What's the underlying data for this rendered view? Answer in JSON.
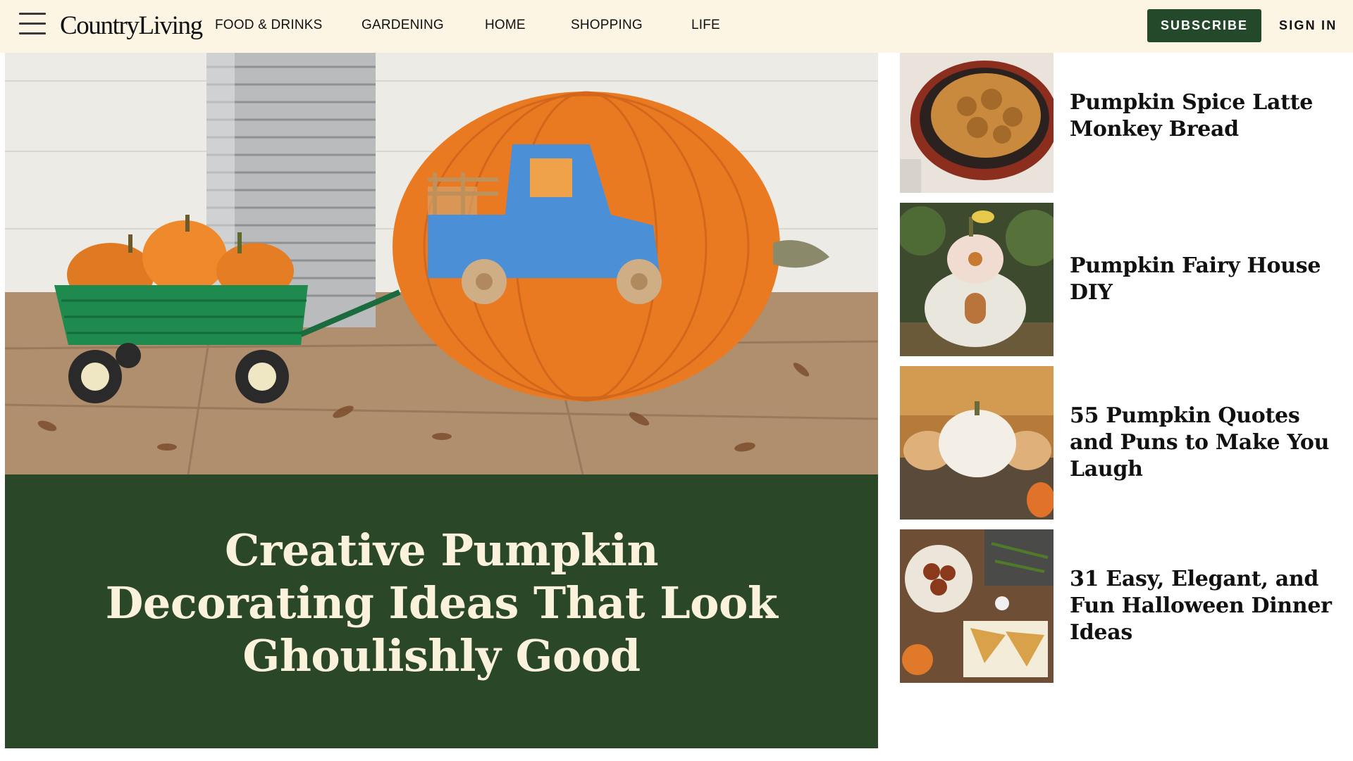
{
  "header": {
    "logo": "CountryLiving",
    "nav": [
      "FOOD & DRINKS",
      "GARDENING",
      "HOME",
      "SHOPPING",
      "LIFE"
    ],
    "subscribe_label": "SUBSCRIBE",
    "signin_label": "SIGN IN"
  },
  "hero": {
    "title": "Creative Pumpkin Decorating Ideas That Look Ghoulishly Good"
  },
  "sidebar": {
    "items": [
      {
        "title": "Pumpkin Spice Latte Monkey Bread"
      },
      {
        "title": "Pumpkin Fairy House DIY"
      },
      {
        "title": "55 Pumpkin Quotes and Puns to Make You Laugh"
      },
      {
        "title": "31 Easy, Elegant, and Fun Halloween Dinner Ideas"
      }
    ]
  },
  "colors": {
    "header_bg": "#fcf5e4",
    "brand_green": "#23482a",
    "hero_panel": "#2a4827",
    "hero_text": "#fbf2dc"
  },
  "icons": [
    "hamburger-menu-icon"
  ]
}
